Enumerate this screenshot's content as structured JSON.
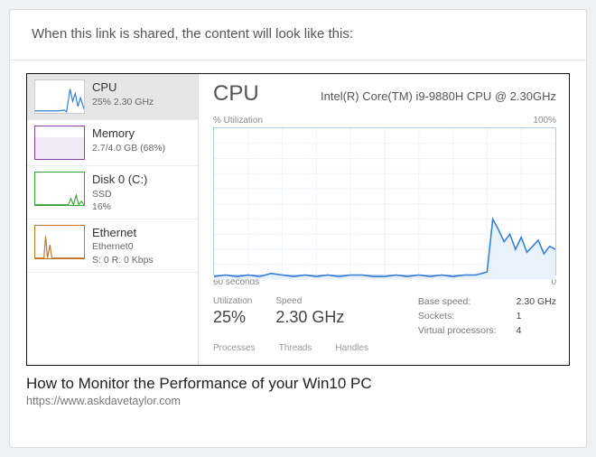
{
  "intro": "When this link is shared, the content will look like this:",
  "link": {
    "title": "How to Monitor the Performance of your Win10 PC",
    "url": "https://www.askdavetaylor.com"
  },
  "sidebar": {
    "items": [
      {
        "title": "CPU",
        "sub": "25% 2.30 GHz",
        "color": "#2f7cd6"
      },
      {
        "title": "Memory",
        "sub": "2.7/4.0 GB (68%)",
        "color": "#8f3fa8"
      },
      {
        "title": "Disk 0 (C:)",
        "sub": "SSD",
        "sub2": "16%",
        "color": "#3aa33a"
      },
      {
        "title": "Ethernet",
        "sub": "Ethernet0",
        "sub2": "S: 0 R: 0 Kbps",
        "color": "#c2732a"
      }
    ]
  },
  "main": {
    "title": "CPU",
    "model": "Intel(R) Core(TM) i9-9880H CPU @ 2.30GHz",
    "chartTop": {
      "left": "% Utilization",
      "right": "100%"
    },
    "chartBottom": {
      "left": "60 seconds",
      "right": "0"
    },
    "stats": [
      {
        "label": "Utilization",
        "value": "25%"
      },
      {
        "label": "Speed",
        "value": "2.30 GHz"
      }
    ],
    "details": [
      {
        "label": "Base speed:",
        "value": "2.30 GHz"
      },
      {
        "label": "Sockets:",
        "value": "1"
      },
      {
        "label": "Virtual processors:",
        "value": "4"
      }
    ],
    "cutoffLabels": [
      "Processes",
      "Threads",
      "Handles"
    ]
  },
  "chart_data": {
    "type": "line",
    "title": "% Utilization",
    "xlabel": "60 seconds",
    "ylabel": "% Utilization",
    "ylim": [
      0,
      100
    ],
    "xlim": [
      60,
      0
    ],
    "x": [
      60,
      58,
      56,
      54,
      52,
      50,
      48,
      46,
      44,
      42,
      40,
      38,
      36,
      34,
      32,
      30,
      28,
      26,
      24,
      22,
      20,
      18,
      16,
      14,
      12,
      11,
      10,
      9,
      8,
      7,
      6,
      5,
      4,
      3,
      2,
      1,
      0
    ],
    "values": [
      2,
      3,
      2,
      3,
      2,
      4,
      3,
      2,
      3,
      2,
      3,
      2,
      3,
      3,
      2,
      2,
      3,
      2,
      3,
      2,
      3,
      2,
      3,
      3,
      5,
      40,
      33,
      25,
      30,
      20,
      28,
      18,
      22,
      26,
      17,
      22,
      20
    ]
  }
}
